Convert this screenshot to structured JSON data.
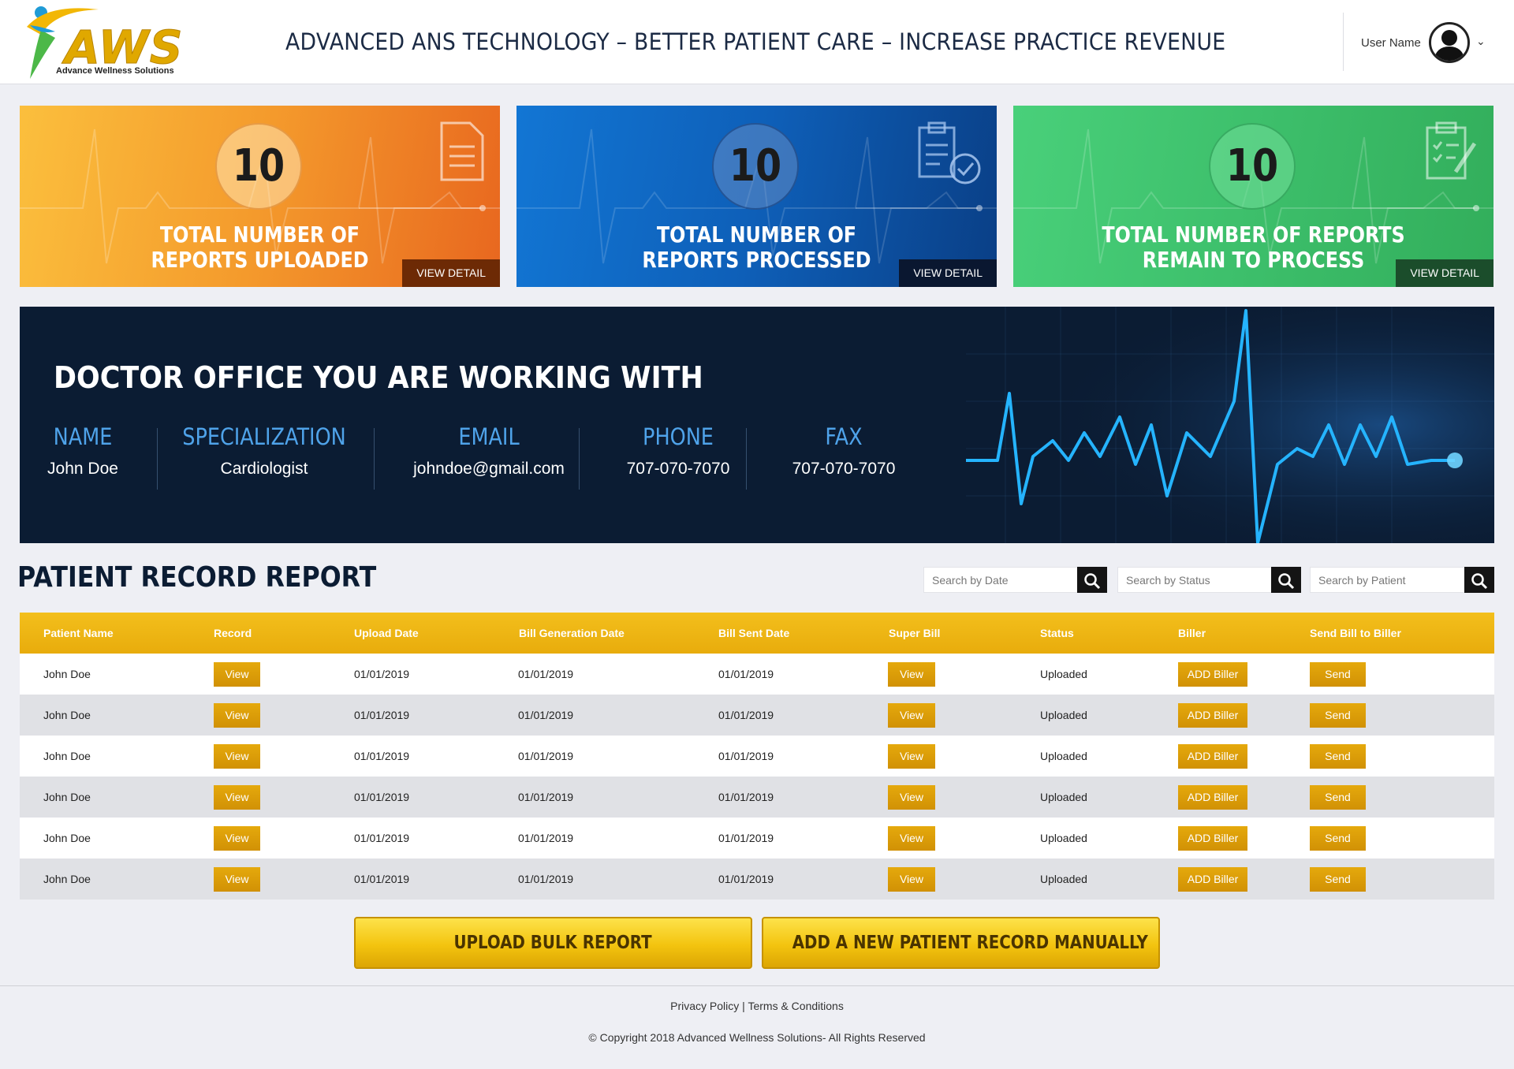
{
  "header": {
    "logo_text": "AWS",
    "logo_subtitle": "Advance Wellness Solutions",
    "tagline": "ADVANCED ANS TECHNOLOGY – BETTER PATIENT CARE – INCREASE PRACTICE REVENUE",
    "user_name": "User Name"
  },
  "stats": [
    {
      "count": "10",
      "title_line1": "TOTAL NUMBER OF",
      "title_line2": "REPORTS UPLOADED",
      "action": "VIEW DETAIL",
      "icon": "document-icon"
    },
    {
      "count": "10",
      "title_line1": "TOTAL NUMBER OF",
      "title_line2": "REPORTS PROCESSED",
      "action": "VIEW DETAIL",
      "icon": "clipboard-check-icon"
    },
    {
      "count": "10",
      "title_line1": "TOTAL NUMBER OF REPORTS",
      "title_line2": "REMAIN TO PROCESS",
      "action": "VIEW DETAIL",
      "icon": "clipboard-edit-icon"
    }
  ],
  "doctor": {
    "title": "DOCTOR OFFICE YOU ARE WORKING WITH",
    "fields": [
      {
        "label": "NAME",
        "value": "John Doe"
      },
      {
        "label": "SPECIALIZATION",
        "value": "Cardiologist"
      },
      {
        "label": "EMAIL",
        "value": "johndoe@gmail.com"
      },
      {
        "label": "PHONE",
        "value": "707-070-7070"
      },
      {
        "label": "FAX",
        "value": "707-070-7070"
      }
    ]
  },
  "records": {
    "title": "PATIENT RECORD REPORT",
    "search": [
      {
        "placeholder": "Search by Date"
      },
      {
        "placeholder": "Search by Status"
      },
      {
        "placeholder": "Search by Patient"
      }
    ],
    "columns": [
      "Patient Name",
      "Record",
      "Upload Date",
      "Bill Generation Date",
      "Bill Sent Date",
      "Super Bill",
      "Status",
      "Biller",
      "Send Bill to Biller"
    ],
    "rows": [
      {
        "patient": "John Doe",
        "record": "View",
        "upload": "01/01/2019",
        "bill_gen": "01/01/2019",
        "bill_sent": "01/01/2019",
        "super_bill": "View",
        "status": "Uploaded",
        "biller": "ADD Biller",
        "send": "Send"
      },
      {
        "patient": "John Doe",
        "record": "View",
        "upload": "01/01/2019",
        "bill_gen": "01/01/2019",
        "bill_sent": "01/01/2019",
        "super_bill": "View",
        "status": "Uploaded",
        "biller": "ADD Biller",
        "send": "Send"
      },
      {
        "patient": "John Doe",
        "record": "View",
        "upload": "01/01/2019",
        "bill_gen": "01/01/2019",
        "bill_sent": "01/01/2019",
        "super_bill": "View",
        "status": "Uploaded",
        "biller": "ADD Biller",
        "send": "Send"
      },
      {
        "patient": "John Doe",
        "record": "View",
        "upload": "01/01/2019",
        "bill_gen": "01/01/2019",
        "bill_sent": "01/01/2019",
        "super_bill": "View",
        "status": "Uploaded",
        "biller": "ADD Biller",
        "send": "Send"
      },
      {
        "patient": "John Doe",
        "record": "View",
        "upload": "01/01/2019",
        "bill_gen": "01/01/2019",
        "bill_sent": "01/01/2019",
        "super_bill": "View",
        "status": "Uploaded",
        "biller": "ADD Biller",
        "send": "Send"
      },
      {
        "patient": "John Doe",
        "record": "View",
        "upload": "01/01/2019",
        "bill_gen": "01/01/2019",
        "bill_sent": "01/01/2019",
        "super_bill": "View",
        "status": "Uploaded",
        "biller": "ADD Biller",
        "send": "Send"
      }
    ]
  },
  "actions": {
    "upload_bulk": "UPLOAD BULK REPORT",
    "add_manual": "ADD A NEW PATIENT RECORD MANUALLY"
  },
  "footer": {
    "privacy": "Privacy Policy",
    "separator": "|",
    "terms": "Terms & Conditions",
    "copyright": "© Copyright 2018 Advanced Wellness Solutions- All Rights Reserved"
  },
  "colors": {
    "accent_gold": "#e8ac0c",
    "card_orange": "#f49a2c",
    "card_blue": "#0e5fb8",
    "card_green": "#3dbf6b",
    "navy": "#0b1c33",
    "label_blue": "#4fa3ea"
  }
}
